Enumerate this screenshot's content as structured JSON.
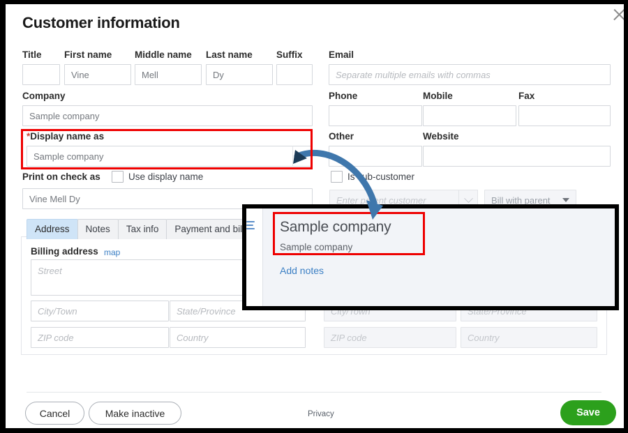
{
  "dialog": {
    "title": "Customer information",
    "close_icon": "close-icon"
  },
  "name_row": {
    "title": {
      "label": "Title",
      "value": ""
    },
    "first_name": {
      "label": "First name",
      "value": "Vine"
    },
    "middle_name": {
      "label": "Middle name",
      "value": "Mell"
    },
    "last_name": {
      "label": "Last name",
      "value": "Dy"
    },
    "suffix": {
      "label": "Suffix",
      "value": ""
    }
  },
  "company": {
    "label": "Company",
    "value": "Sample company"
  },
  "display_name": {
    "label": "Display name as",
    "required_marker": "*",
    "value": "Sample company",
    "caret_icon": "chevron-down-icon",
    "highlighted": true
  },
  "print_on_check": {
    "label": "Print on check as",
    "checkbox_label": "Use display name",
    "checked": false,
    "value": "Vine Mell Dy"
  },
  "contact": {
    "email": {
      "label": "Email",
      "placeholder": "Separate multiple emails with commas",
      "value": ""
    },
    "phone": {
      "label": "Phone",
      "value": ""
    },
    "mobile": {
      "label": "Mobile",
      "value": ""
    },
    "fax": {
      "label": "Fax",
      "value": ""
    },
    "other": {
      "label": "Other",
      "value": ""
    },
    "website": {
      "label": "Website",
      "value": ""
    }
  },
  "sub_customer": {
    "checkbox_label": "Is sub-customer",
    "checked": false,
    "parent_placeholder": "Enter parent customer",
    "parent_caret_icon": "chevron-down-icon",
    "billing_option": "Bill with parent",
    "billing_caret_icon": "caret-down-icon",
    "disabled": true
  },
  "tabs": [
    {
      "label": "Address",
      "active": true
    },
    {
      "label": "Notes",
      "active": false
    },
    {
      "label": "Tax info",
      "active": false
    },
    {
      "label": "Payment and billing",
      "active": false
    }
  ],
  "grip_icon": "drag-handle-icon",
  "billing_address": {
    "heading": "Billing address",
    "map_link": "map",
    "street_placeholder": "Street",
    "city_placeholder": "City/Town",
    "state_placeholder": "State/Province",
    "zip_placeholder": "ZIP code",
    "country_placeholder": "Country"
  },
  "shipping_address": {
    "city_placeholder": "City/Town",
    "state_placeholder": "State/Province",
    "zip_placeholder": "ZIP code",
    "country_placeholder": "Country"
  },
  "overlay": {
    "title": "Sample company",
    "subtitle": "Sample company",
    "link": "Add notes",
    "grip_icon": "drag-handle-icon",
    "highlighted": true
  },
  "footer": {
    "cancel": "Cancel",
    "make_inactive": "Make inactive",
    "privacy": "Privacy",
    "save": "Save"
  },
  "colors": {
    "save_green": "#2CA01C",
    "highlight_red": "#EE0000",
    "link_blue": "#3B7FC4",
    "active_tab_blue": "#CFE4F7",
    "arrow_blue": "#3F77AC",
    "required_star": "#D04437"
  }
}
